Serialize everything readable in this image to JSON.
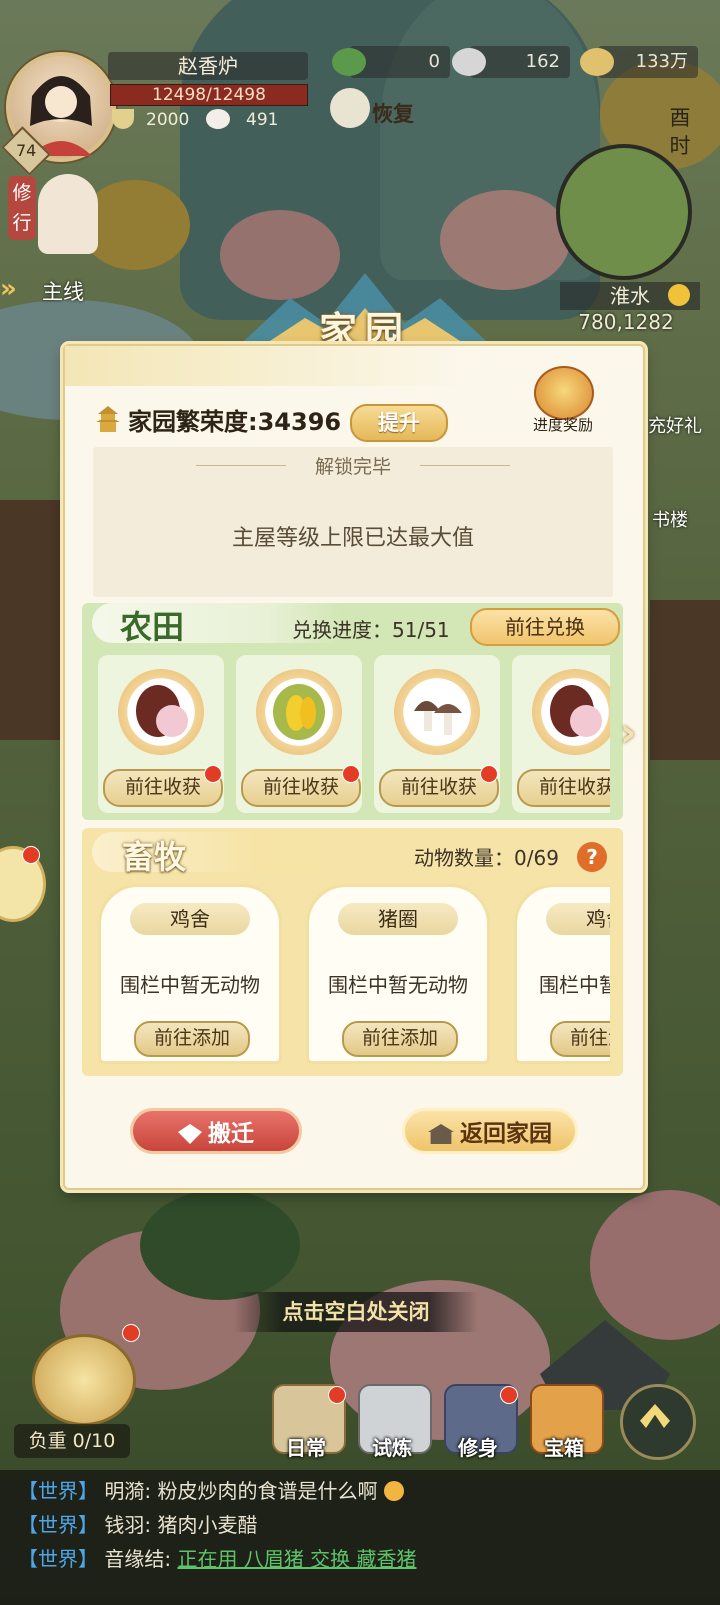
{
  "player": {
    "name": "赵香炉",
    "hp": "12498/12498",
    "stat1": "2000",
    "stat2": "491",
    "level": "74"
  },
  "currencies": [
    {
      "icon": "jade-icon",
      "value": "0"
    },
    {
      "icon": "silver-ingot-icon",
      "value": "162"
    },
    {
      "icon": "coins-icon",
      "value": "133万"
    }
  ],
  "hud": {
    "restore_label": "恢复",
    "training_label": "修行",
    "mainline_label": "主线",
    "time_label": "酉时",
    "location_name": "淮水",
    "location_coords": "780,1282",
    "side_gift_label": "充好礼",
    "side_tower_label": "书楼"
  },
  "panel": {
    "title": "家园",
    "prosperity_label": "家园繁荣度:",
    "prosperity_value": "34396",
    "upgrade_label": "提升",
    "reward_label": "进度奖励",
    "unlock_title": "解锁完毕",
    "unlock_message": "主屋等级上限已达最大值"
  },
  "farm": {
    "title": "农田",
    "progress_label": "兑换进度：",
    "progress_value": "51/51",
    "exchange_label": "前往兑换",
    "crops": [
      {
        "icon": "taro-icon",
        "button": "前往收获"
      },
      {
        "icon": "durian-icon",
        "button": "前往收获"
      },
      {
        "icon": "mushroom-icon",
        "button": "前往收获"
      },
      {
        "icon": "taro-icon",
        "button": "前往收获"
      }
    ]
  },
  "livestock": {
    "title": "畜牧",
    "count_label": "动物数量：",
    "count_value": "0/69",
    "help": "?",
    "pens": [
      {
        "name": "鸡舍",
        "message": "围栏中暂无动物",
        "button": "前往添加"
      },
      {
        "name": "猪圈",
        "message": "围栏中暂无动物",
        "button": "前往添加"
      },
      {
        "name": "鸡舍",
        "message": "围栏中暂无动物",
        "button": "前往添加"
      }
    ]
  },
  "actions": {
    "move_label": "搬迁",
    "return_label": "返回家园"
  },
  "close_hint": "点击空白处关闭",
  "bottom": {
    "load_label": "负重 0/10",
    "menu": [
      {
        "icon": "daily-icon",
        "label": "日常"
      },
      {
        "icon": "trial-icon",
        "label": "试炼"
      },
      {
        "icon": "cultivate-icon",
        "label": "修身"
      },
      {
        "icon": "treasure-chest-icon",
        "label": "宝箱"
      }
    ]
  },
  "chat": [
    {
      "channel": "【世界】",
      "name": "明漪:",
      "text": " 粉皮炒肉的食谱是什么啊",
      "link": ""
    },
    {
      "channel": "【世界】",
      "name": "钱羽:",
      "text": " 猪肉小麦醋",
      "link": ""
    },
    {
      "channel": "【世界】",
      "name": "音缘结:",
      "text": " ",
      "link": "正在用 八眉猪 交换 藏香猪"
    }
  ],
  "colors": {
    "panel_bg": "#fbf7ea",
    "farm_bg": "#d2e6b6",
    "livestock_bg": "#f5e3a7",
    "move_button": "#d9534a",
    "return_button": "#f0c56c",
    "chat_channel": "#4ea6e8",
    "chat_link": "#5ec46a"
  }
}
